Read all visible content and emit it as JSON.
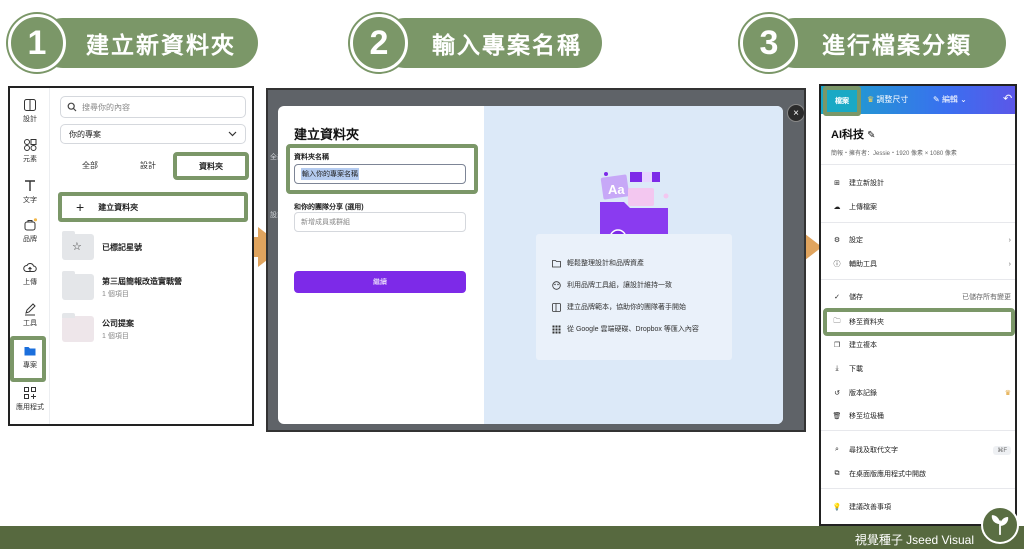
{
  "steps": [
    {
      "number": "1",
      "title": "建立新資料夾"
    },
    {
      "number": "2",
      "title": "輸入專案名稱"
    },
    {
      "number": "3",
      "title": "進行檔案分類"
    }
  ],
  "panel1": {
    "rail": [
      {
        "label": "設計",
        "icon": "layout-icon"
      },
      {
        "label": "元素",
        "icon": "elements-icon"
      },
      {
        "label": "文字",
        "icon": "text-icon"
      },
      {
        "label": "品牌",
        "icon": "brand-icon"
      },
      {
        "label": "上傳",
        "icon": "upload-icon"
      },
      {
        "label": "工具",
        "icon": "pen-icon"
      },
      {
        "label": "專案",
        "icon": "folder-icon"
      },
      {
        "label": "應用程式",
        "icon": "apps-icon"
      }
    ],
    "search_placeholder": "搜尋你的內容",
    "select_value": "你的專案",
    "tabs": [
      "全部",
      "設計",
      "資料夾"
    ],
    "create_label": "建立資料夾",
    "folders": [
      {
        "name": "已標記星號",
        "sub": ""
      },
      {
        "name": "第三屆簡報改造實戰營",
        "sub": "1 個項目"
      },
      {
        "name": "公司提案",
        "sub": "1 個項目"
      }
    ]
  },
  "panel2": {
    "title": "建立資料夾",
    "name_label": "資料夾名稱",
    "name_value": "輸入你的專案名稱",
    "share_label": "和你的團隊分享 (選用)",
    "share_placeholder": "新增成員或群組",
    "button": "繼續",
    "bg_tabs": [
      "全部",
      "設計"
    ],
    "features": [
      "輕鬆整理設計和品牌資產",
      "利用品牌工具組，讓設計維持一致",
      "建立品牌範本，協助你的團隊著手開始",
      "從 Google 雲端硬碟、Dropbox 等匯入內容"
    ],
    "close": "×"
  },
  "panel3": {
    "top": {
      "file": "檔案",
      "resize": "調整尺寸",
      "edit": "編輯"
    },
    "title": "AI科技",
    "meta": "簡報・擁有者：Jessie・1920 像素 × 1080 像素",
    "menu": [
      {
        "label": "建立新設計",
        "icon": "plus-icon",
        "right": ""
      },
      {
        "label": "上傳檔案",
        "icon": "cloud-upload-icon",
        "right": ""
      },
      {
        "label": "設定",
        "icon": "gear-icon",
        "right": "›"
      },
      {
        "label": "輔助工具",
        "icon": "accessibility-icon",
        "right": "›"
      },
      {
        "label": "儲存",
        "icon": "cloud-check-icon",
        "right": "已儲存所有變更"
      },
      {
        "label": "移至資料夾",
        "icon": "folder-icon",
        "right": ""
      },
      {
        "label": "建立複本",
        "icon": "copy-icon",
        "right": ""
      },
      {
        "label": "下載",
        "icon": "download-icon",
        "right": ""
      },
      {
        "label": "版本記錄",
        "icon": "history-icon",
        "right": "♛"
      },
      {
        "label": "移至垃圾桶",
        "icon": "trash-icon",
        "right": ""
      },
      {
        "label": "尋找及取代文字",
        "icon": "search-icon",
        "right": "⌘F"
      },
      {
        "label": "在桌面版應用程式中開啟",
        "icon": "external-icon",
        "right": ""
      },
      {
        "label": "建議改善事項",
        "icon": "bulb-icon",
        "right": ""
      }
    ]
  },
  "footer": {
    "brand": "視覺種子 Jseed Visual"
  },
  "colors": {
    "accent": "#7b9768",
    "footer": "#57693f",
    "arrow": "#e0a45e",
    "canva_purple": "#7d2ae8"
  }
}
